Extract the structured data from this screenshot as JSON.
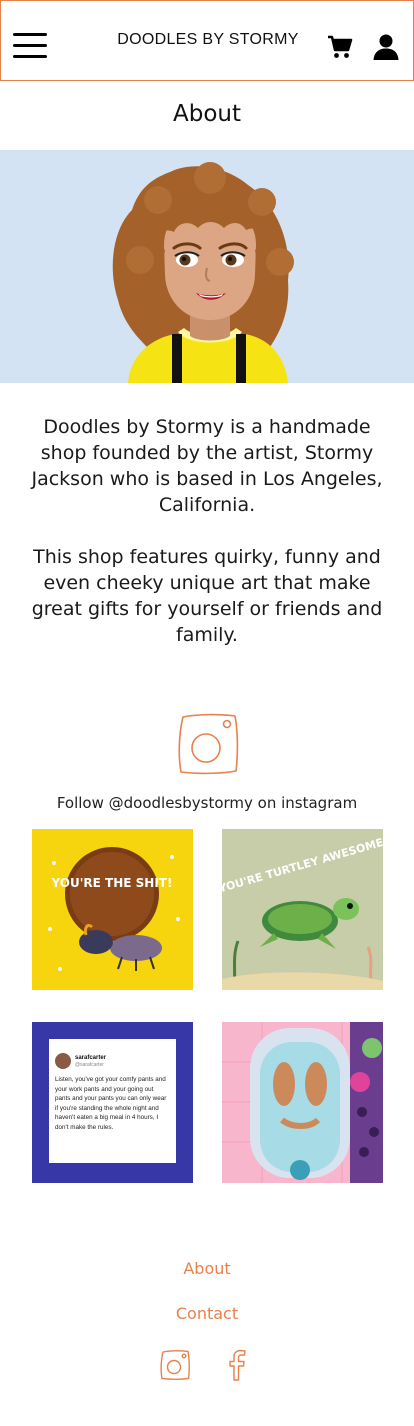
{
  "header": {
    "brand": "DOODLES BY STORMY",
    "menu_icon": "hamburger-menu-icon",
    "cart_icon": "cart-icon",
    "user_icon": "user-icon"
  },
  "page": {
    "title": "About"
  },
  "about": {
    "paragraph1": "Doodles by Stormy is a handmade shop founded by the artist, Stormy Jackson who is based in Los Angeles, California.",
    "paragraph2": "This shop features quirky, funny and even cheeky unique art that make great gifts for yourself or friends and family."
  },
  "instagram": {
    "follow_text": "Follow @doodlesbystormy on instagram",
    "posts": [
      {
        "text": "YOU'RE THE SHIT!"
      },
      {
        "text": "YOU'RE TURTLEY AWESOME"
      },
      {
        "tweet_name": "sarafcarter",
        "tweet_handle": "@sarafcarter",
        "tweet_text": "Listen, you've got your comfy pants and your work pants and your going out pants and your pants you can only wear if you're standing the whole night and haven't eaten a big meal in 4 hours, I don't make the rules."
      },
      {
        "text": ""
      }
    ]
  },
  "footer": {
    "about": "About",
    "contact": "Contact",
    "instagram_icon": "instagram-icon",
    "facebook_icon": "facebook-icon"
  },
  "colors": {
    "accent": "#e8814a",
    "hero_bg": "#d3e3f3"
  }
}
